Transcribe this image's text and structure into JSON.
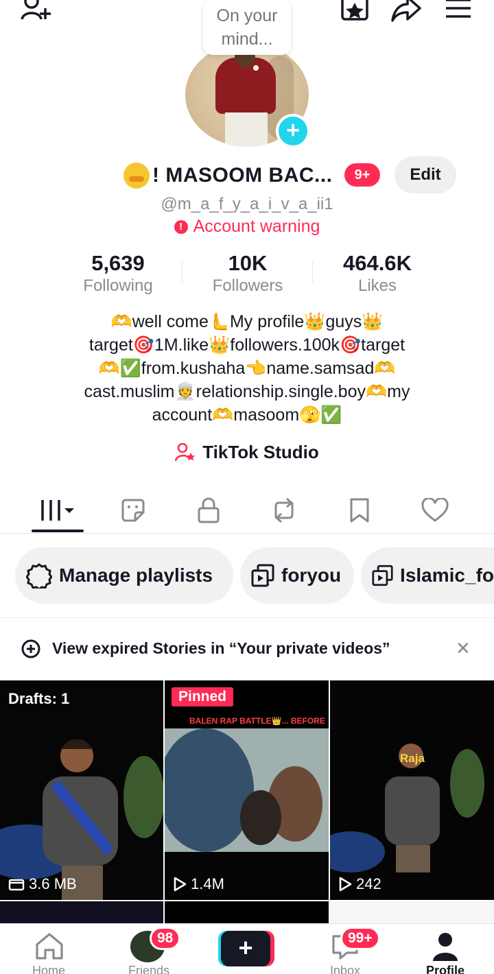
{
  "top_bar": {
    "add_friend_icon": "person-plus-icon",
    "badge_icon": "star-square-icon",
    "share_icon": "share-arrow-icon",
    "menu_icon": "hamburger-menu-icon"
  },
  "profile": {
    "note_bubble": "On your mind...",
    "display_name": "! MASOOM BAC...",
    "notification_count": "9+",
    "edit_label": "Edit",
    "handle": "@m_a_f_y_a_i_v_a_ii1",
    "warning_text": "Account warning"
  },
  "stats": [
    {
      "value": "5,639",
      "label": "Following"
    },
    {
      "value": "10K",
      "label": "Followers"
    },
    {
      "value": "464.6K",
      "label": "Likes"
    }
  ],
  "bio": [
    "🫶well come🫷My profile👑guys👑",
    "target🎯1M.like👑followers.100k🎯target",
    "🫶✅from.kushaha👈name.samsad🫶",
    "cast.muslim👳relationship.single.boy🫶my",
    "account🫶masoom🫣✅"
  ],
  "studio_label": "TikTok Studio",
  "tabs": [
    "videos-grid-icon",
    "stickers-icon",
    "lock-icon",
    "repost-icon",
    "bookmark-icon",
    "heart-icon"
  ],
  "chips": [
    {
      "label": "Manage playlists",
      "icon": "gear-icon"
    },
    {
      "label": "foryou",
      "icon": "playlist-icon"
    },
    {
      "label": "Islamic_fo",
      "icon": "playlist-icon"
    }
  ],
  "stories_banner": "View expired Stories in “Your private videos”",
  "videos": [
    {
      "top_label": "Drafts: 1",
      "count": "3.6 MB"
    },
    {
      "top_label": "Pinned",
      "caption": "BALEN RAP BATTLE👑... BEFORE",
      "count": "1.4M"
    },
    {
      "caption": "Raja",
      "count": "242"
    }
  ],
  "bottom_nav": [
    {
      "label": "Home"
    },
    {
      "label": "Friends",
      "badge": "98"
    },
    {
      "label": ""
    },
    {
      "label": "Inbox",
      "badge": "99+"
    },
    {
      "label": "Profile"
    }
  ],
  "colors": {
    "accent": "#fe2c55",
    "teal": "#20d5ec",
    "text": "#161823",
    "muted": "#8a8b91"
  }
}
